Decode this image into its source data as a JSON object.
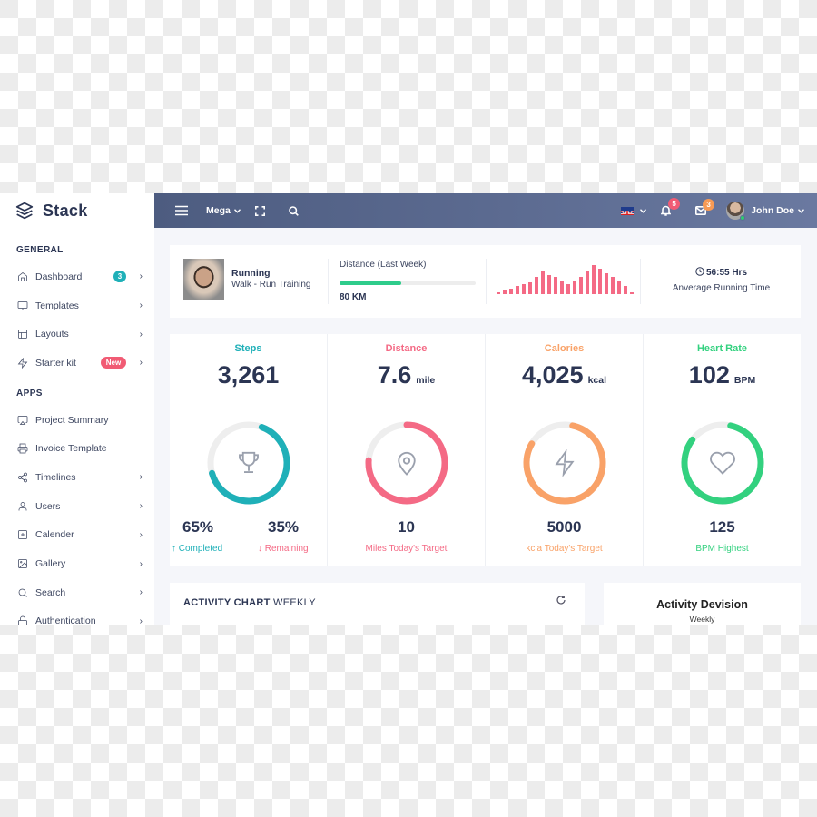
{
  "brand": {
    "name": "Stack",
    "icon": "layers-icon"
  },
  "sidebar": {
    "sections": [
      {
        "title": "GENERAL",
        "items": [
          {
            "label": "Dashboard",
            "icon": "home-icon",
            "badge": "3",
            "badge_color": "#1fb0b8",
            "has_submenu": true
          },
          {
            "label": "Templates",
            "icon": "monitor-icon",
            "has_submenu": true
          },
          {
            "label": "Layouts",
            "icon": "layout-icon",
            "has_submenu": true
          },
          {
            "label": "Starter kit",
            "icon": "zap-icon",
            "badge": "New",
            "badge_color": "#f15b74",
            "has_submenu": true
          }
        ]
      },
      {
        "title": "APPS",
        "items": [
          {
            "label": "Project Summary",
            "icon": "airplay-icon",
            "has_submenu": false
          },
          {
            "label": "Invoice Template",
            "icon": "printer-icon",
            "has_submenu": false
          },
          {
            "label": "Timelines",
            "icon": "share-icon",
            "has_submenu": true
          },
          {
            "label": "Users",
            "icon": "user-icon",
            "has_submenu": true
          },
          {
            "label": "Calender",
            "icon": "plus-square-icon",
            "has_submenu": true
          },
          {
            "label": "Gallery",
            "icon": "image-icon",
            "has_submenu": true
          },
          {
            "label": "Search",
            "icon": "search-icon",
            "has_submenu": true
          },
          {
            "label": "Authentication",
            "icon": "unlock-icon",
            "has_submenu": true
          }
        ]
      }
    ],
    "chevron": "›"
  },
  "topbar": {
    "menu_icon": "hamburger-icon",
    "mega_label": "Mega",
    "mega_caret": "⌄",
    "expand_icon": "maximize-icon",
    "search_icon": "search-icon",
    "language": "en-GB",
    "notifications_count": "5",
    "messages_count": "3",
    "user_name": "John Doe",
    "user_caret": "⌄",
    "colors": {
      "notifications": "#f15b74",
      "messages": "#f79a55"
    }
  },
  "summary": {
    "activity_title": "Running",
    "activity_subtitle": "Walk - Run Training",
    "distance_label": "Distance (Last Week)",
    "distance_progress_percent": 45,
    "distance_value": "80 KM",
    "sparkline_values": [
      1,
      2,
      3,
      4,
      5,
      6,
      9,
      12,
      10,
      9,
      7,
      5,
      7,
      9,
      12,
      15,
      13,
      11,
      9,
      7,
      4,
      1
    ],
    "running_time": "56:55 Hrs",
    "running_time_label": "Anverage Running Time"
  },
  "stats": [
    {
      "title": "Steps",
      "value": "3,261",
      "unit": "",
      "color": "#1fb0b8",
      "progress": 0.65,
      "icon": "trophy-icon",
      "completed_value": "65%",
      "completed_label": "↑ Completed",
      "remaining_value": "35%",
      "remaining_label": "↓ Remaining"
    },
    {
      "title": "Distance",
      "value": "7.6",
      "unit": "mile",
      "color": "#f46a85",
      "progress": 0.76,
      "icon": "map-pin-icon",
      "target_value": "10",
      "target_label": "Miles Today's Target"
    },
    {
      "title": "Calories",
      "value": "4,025",
      "unit": "kcal",
      "color": "#f9a268",
      "progress": 0.8,
      "icon": "zap-icon",
      "target_value": "5000",
      "target_label": "kcla Today's Target"
    },
    {
      "title": "Heart Rate",
      "value": "102",
      "unit": "BPM",
      "color": "#33d17f",
      "progress": 0.82,
      "icon": "heart-icon",
      "target_value": "125",
      "target_label": "BPM Highest"
    }
  ],
  "activity_chart": {
    "title_bold": "ACTIVITY CHART",
    "title_rest": "WEEKLY",
    "refresh_icon": "refresh-icon"
  },
  "activity_division": {
    "title": "Activity Devision",
    "subtitle": "Weekly"
  }
}
